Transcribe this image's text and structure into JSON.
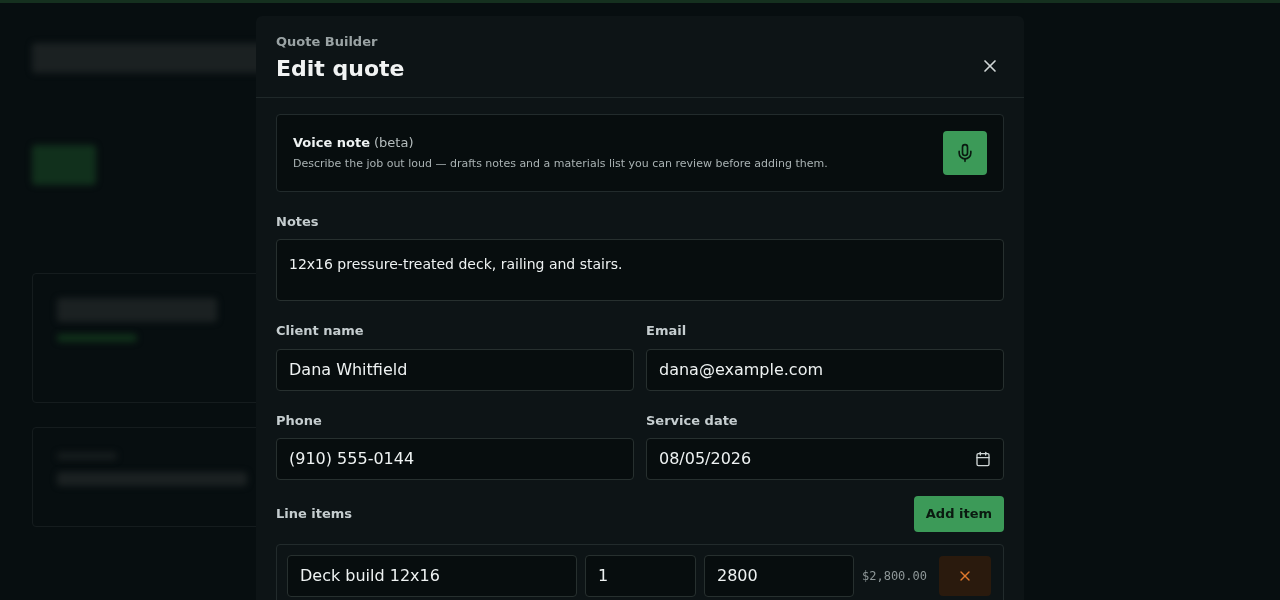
{
  "dialog": {
    "eyebrow": "Quote Builder",
    "title": "Edit quote",
    "voice_note": {
      "title": "Voice note",
      "tag": "(beta)",
      "description": "Describe the job out loud — drafts notes and a materials list you can review before adding them."
    },
    "notes": {
      "label": "Notes",
      "value": "12x16 pressure-treated deck, railing and stairs."
    },
    "fields": [
      {
        "label": "Client name",
        "value": "Dana Whitfield",
        "kind": "text"
      },
      {
        "label": "Email",
        "value": "dana@example.com",
        "kind": "text"
      },
      {
        "label": "Phone",
        "value": "(910) 555-0144",
        "kind": "text"
      },
      {
        "label": "Service date",
        "value": "08/05/2026",
        "kind": "date"
      }
    ],
    "line_items": {
      "label": "Line items",
      "add_button": "Add item",
      "items": [
        {
          "description": "Deck build 12x16",
          "quantity": "1",
          "price": "2800",
          "total": "$2,800.00"
        }
      ]
    }
  }
}
